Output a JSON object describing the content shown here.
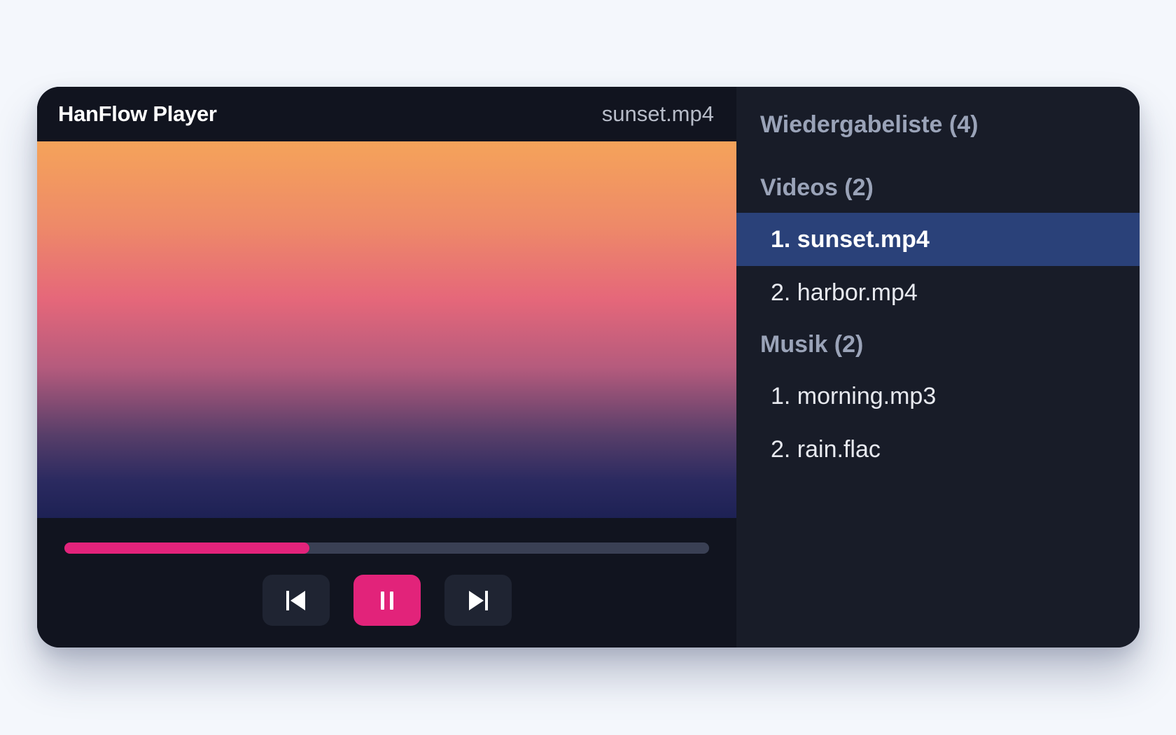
{
  "player": {
    "title": "HanFlow Player",
    "current_file": "sunset.mp4",
    "progress": 0.38,
    "controls": {
      "previous_icon": "skip-previous-icon",
      "pause_icon": "pause-icon",
      "next_icon": "skip-next-icon"
    },
    "colors": {
      "accent": "#e2237a",
      "active_item": "#2a4179"
    }
  },
  "playlist": {
    "title": "Wiedergabeliste (4)",
    "sections": [
      {
        "title": "Videos (2)",
        "items": [
          {
            "label": "1. sunset.mp4",
            "active": true
          },
          {
            "label": "2. harbor.mp4",
            "active": false
          }
        ]
      },
      {
        "title": "Musik (2)",
        "items": [
          {
            "label": "1. morning.mp3",
            "active": false
          },
          {
            "label": "2. rain.flac",
            "active": false
          }
        ]
      }
    ]
  }
}
